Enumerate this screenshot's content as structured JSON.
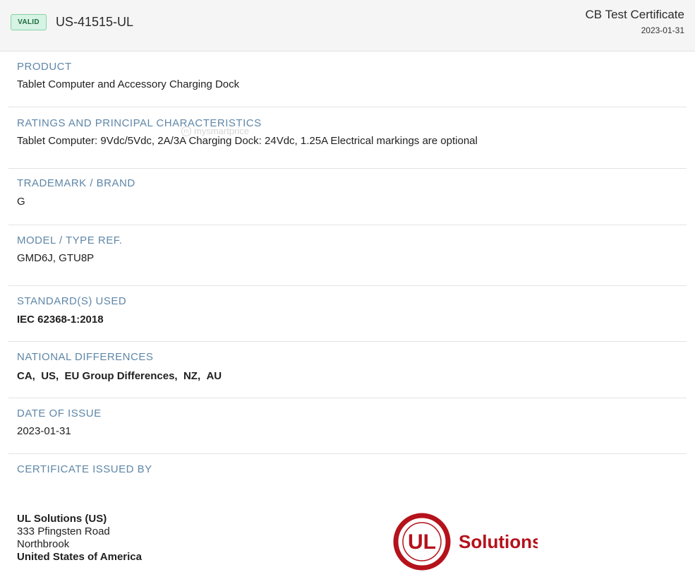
{
  "header": {
    "status_badge": "VALID",
    "certificate_id": "US-41515-UL",
    "certificate_type": "CB Test Certificate",
    "date": "2023-01-31"
  },
  "watermark": "mysmartprice",
  "sections": {
    "product": {
      "label": "PRODUCT",
      "value": "Tablet Computer and Accessory Charging Dock"
    },
    "ratings": {
      "label": "RATINGS AND PRINCIPAL CHARACTERISTICS",
      "value": "Tablet Computer: 9Vdc/5Vdc, 2A/3A Charging Dock: 24Vdc, 1.25A Electrical markings are optional"
    },
    "trademark": {
      "label": "TRADEMARK / BRAND",
      "value": "G"
    },
    "model": {
      "label": "MODEL / TYPE REF.",
      "value": "GMD6J, GTU8P"
    },
    "standards": {
      "label": "STANDARD(S) USED",
      "value": "IEC 62368-1:2018"
    },
    "national_differences": {
      "label": "NATIONAL DIFFERENCES",
      "items": [
        "CA",
        "US",
        "EU Group Differences",
        "NZ",
        "AU"
      ]
    },
    "date_of_issue": {
      "label": "DATE OF ISSUE",
      "value": "2023-01-31"
    },
    "issued_by": {
      "label": "CERTIFICATE ISSUED BY",
      "name": "UL Solutions (US)",
      "street": "333 Pfingsten Road",
      "city": "Northbrook",
      "country": "United States of America"
    }
  },
  "logo": {
    "mark": "UL",
    "text": "Solutions",
    "color": "#b5121b"
  },
  "colors": {
    "label": "#5f87a8",
    "badge_bg": "#d6f3e3",
    "badge_text": "#1e6b40",
    "header_bg": "#f5f5f5"
  }
}
